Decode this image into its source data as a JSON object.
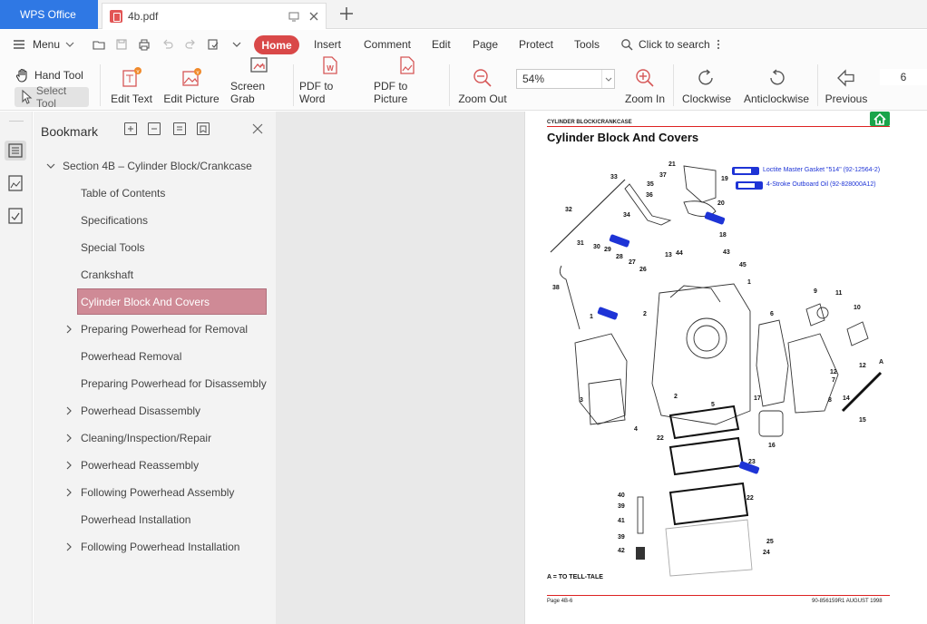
{
  "titlebar": {
    "app_name": "WPS Office",
    "doc_tab": "4b.pdf"
  },
  "menubar": {
    "menu_label": "Menu",
    "tabs": [
      "Home",
      "Insert",
      "Comment",
      "Edit",
      "Page",
      "Protect",
      "Tools"
    ],
    "search_label": "Click to search"
  },
  "toolbar": {
    "hand_tool": "Hand Tool",
    "select_tool": "Select Tool",
    "buttons": [
      "Edit Text",
      "Edit Picture",
      "Screen Grab",
      "PDF to Word",
      "PDF to Picture",
      "Zoom Out",
      "Zoom In",
      "Clockwise",
      "Anticlockwise",
      "Previous"
    ],
    "zoom_value": "54%",
    "page_number": "6"
  },
  "bookmark": {
    "title": "Bookmark",
    "items": [
      {
        "label": "Section 4B – Cylinder Block/Crankcase",
        "level": 0,
        "chevron": "down"
      },
      {
        "label": "Table of Contents",
        "level": 1,
        "chevron": ""
      },
      {
        "label": "Specifications",
        "level": 1,
        "chevron": ""
      },
      {
        "label": "Special Tools",
        "level": 1,
        "chevron": ""
      },
      {
        "label": "Crankshaft",
        "level": 1,
        "chevron": ""
      },
      {
        "label": "Cylinder Block And Covers",
        "level": 1,
        "chevron": "",
        "active": true
      },
      {
        "label": "Preparing Powerhead for Removal",
        "level": 1,
        "chevron": "right"
      },
      {
        "label": "Powerhead Removal",
        "level": 1,
        "chevron": ""
      },
      {
        "label": "Preparing Powerhead for Disassembly",
        "level": 1,
        "chevron": ""
      },
      {
        "label": "Powerhead Disassembly",
        "level": 1,
        "chevron": "right"
      },
      {
        "label": "Cleaning/Inspection/Repair",
        "level": 1,
        "chevron": "right"
      },
      {
        "label": "Powerhead Reassembly",
        "level": 1,
        "chevron": "right"
      },
      {
        "label": "Following Powerhead Assembly",
        "level": 1,
        "chevron": "right"
      },
      {
        "label": "Powerhead Installation",
        "level": 1,
        "chevron": ""
      },
      {
        "label": "Following Powerhead Installation",
        "level": 1,
        "chevron": "right"
      }
    ]
  },
  "page": {
    "section_header": "CYLINDER BLOCK/CRANKCASE",
    "title": "Cylinder Block And Covers",
    "legend": [
      {
        "tube": "12",
        "text": "Loctite Master Gasket \"514\" (92-12564-2)"
      },
      {
        "tube": "110",
        "text": "4-Stroke Outboard Oil (92-828000A12)"
      }
    ],
    "callouts": [
      "1",
      "2",
      "3",
      "4",
      "5",
      "6",
      "7",
      "8",
      "9",
      "10",
      "11",
      "12",
      "13",
      "14",
      "15",
      "16",
      "17",
      "18",
      "19",
      "20",
      "21",
      "22",
      "23",
      "24",
      "25",
      "26",
      "27",
      "28",
      "29",
      "30",
      "31",
      "32",
      "33",
      "34",
      "35",
      "36",
      "37",
      "38",
      "39",
      "40",
      "41",
      "42",
      "43",
      "44",
      "45",
      "A"
    ],
    "note": "A = TO TELL-TALE",
    "footer_left": "Page 4B-6",
    "footer_right": "90-856159R1   AUGUST 1998"
  },
  "colors": {
    "wps_blue": "#2f78e4",
    "home_red": "#d94848",
    "bookmark_highlight": "#cf8a96",
    "legend_blue": "#1e34d6",
    "rule_red": "#dd2222"
  }
}
